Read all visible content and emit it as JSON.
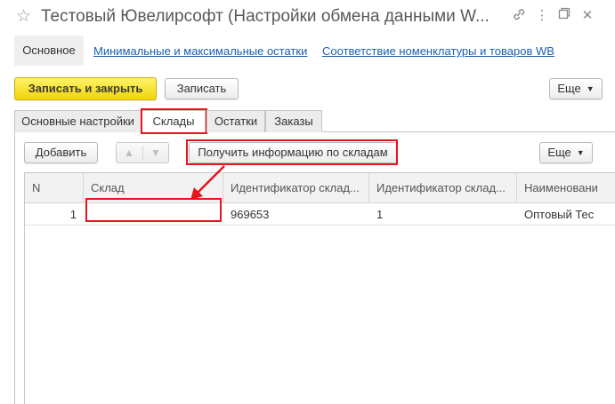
{
  "window": {
    "title": "Тестовый Ювелирсофт (Настройки обмена данными W...",
    "star_icon": "star-icon",
    "link_icon": "link-icon",
    "menu_icon": "kebab-menu-icon",
    "restore_icon": "restore-icon",
    "close_icon": "close-icon"
  },
  "nav": {
    "main": "Основное",
    "links": [
      "Минимальные и максимальные остатки",
      "Соответствие номенклатуры и товаров WB"
    ]
  },
  "toolbar": {
    "save_close": "Записать и закрыть",
    "save": "Записать",
    "more": "Еще"
  },
  "tabs": [
    "Основные настройки",
    "Склады",
    "Остатки",
    "Заказы"
  ],
  "active_tab": "Склады",
  "panel_toolbar": {
    "add": "Добавить",
    "get_info": "Получить информацию по складам",
    "more": "Еще"
  },
  "table": {
    "columns": [
      "N",
      "Склад",
      "Идентификатор склад...",
      "Идентификатор склад...",
      "Наименовани"
    ],
    "rows": [
      [
        "1",
        "",
        "969653",
        "1",
        "Оптовый Тес"
      ]
    ]
  },
  "colors": {
    "annotation": "#e8141b",
    "primary_button": "#f5dd1e",
    "link": "#1b5fb0"
  }
}
